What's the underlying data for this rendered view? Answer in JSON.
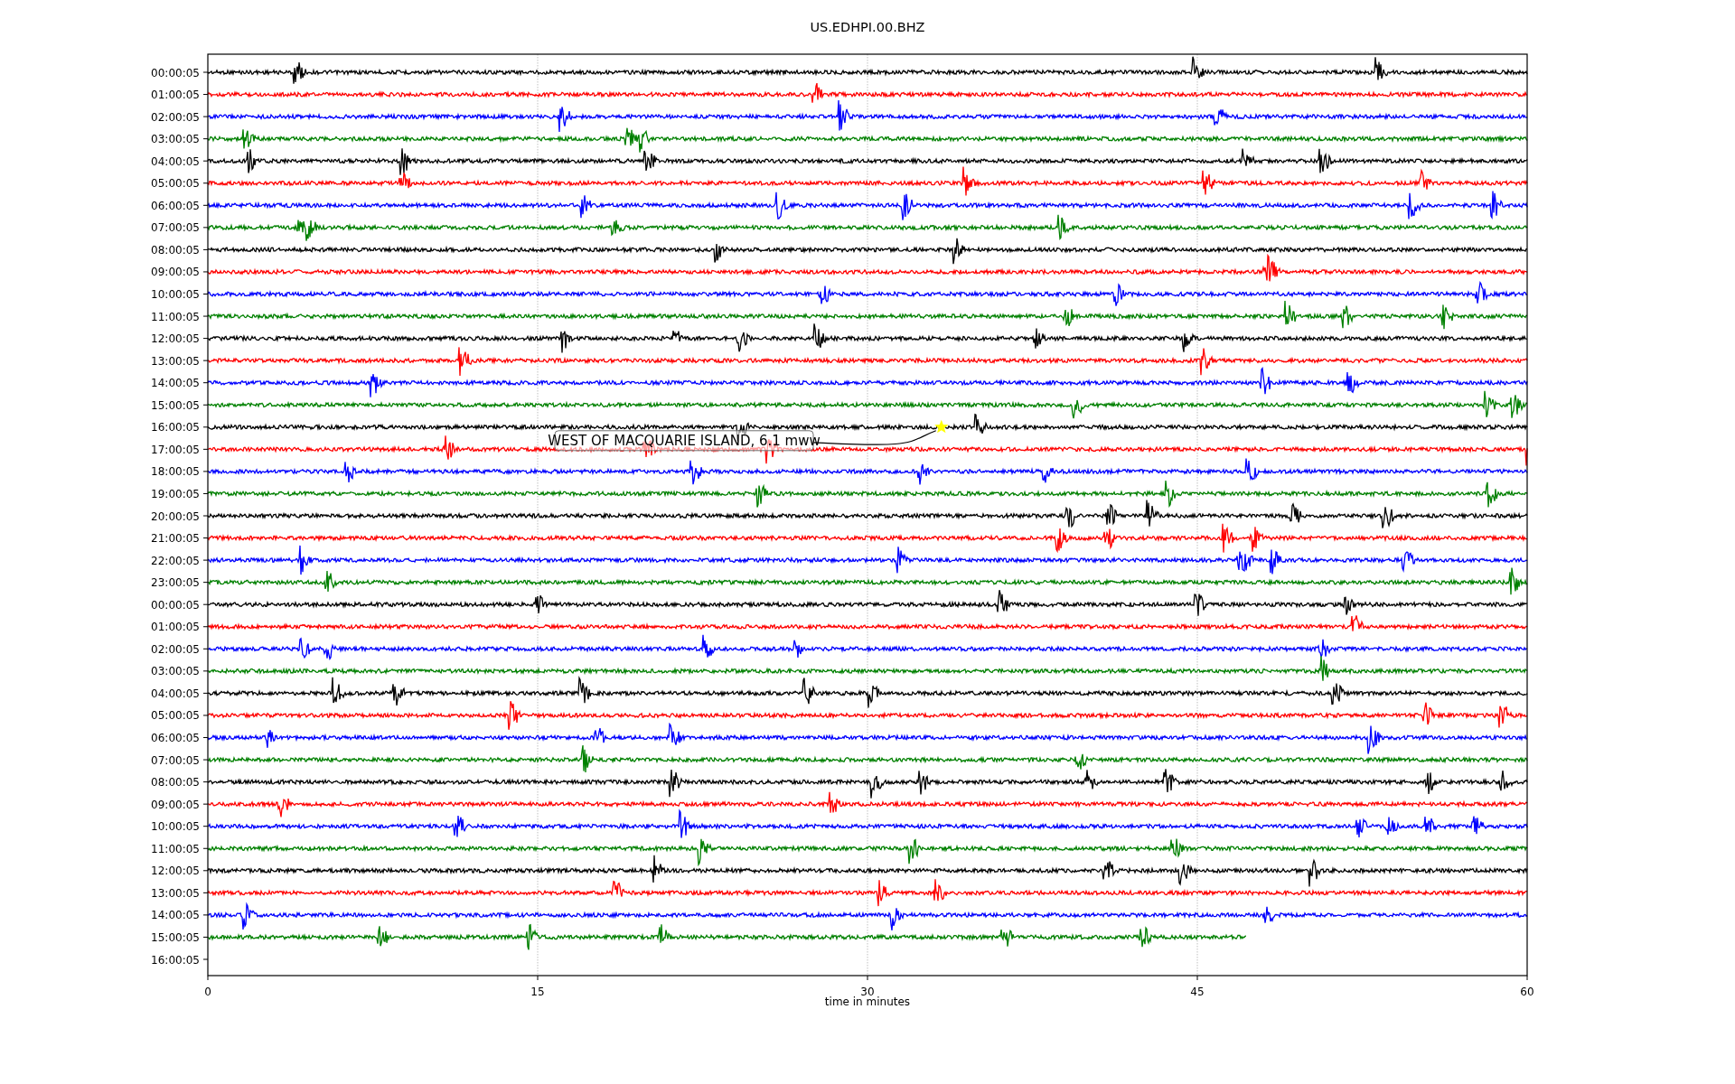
{
  "title": "US.EDHPI.00.BHZ",
  "plot": {
    "xlabel": "time in minutes",
    "xticks": [
      "0",
      "15",
      "30",
      "45",
      "60"
    ],
    "rows": [
      {
        "label": "00:00:05",
        "color": "#000000",
        "level": 1
      },
      {
        "label": "01:00:05",
        "color": "#ff0000",
        "level": 1
      },
      {
        "label": "02:00:05",
        "color": "#0000ff",
        "level": 1
      },
      {
        "label": "03:00:05",
        "color": "#008000",
        "level": 1
      },
      {
        "label": "04:00:05",
        "color": "#000000",
        "level": 1
      },
      {
        "label": "05:00:05",
        "color": "#ff0000",
        "level": 1
      },
      {
        "label": "06:00:05",
        "color": "#0000ff",
        "level": 1
      },
      {
        "label": "07:00:05",
        "color": "#008000",
        "level": 1
      },
      {
        "label": "08:00:05",
        "color": "#000000",
        "level": 1
      },
      {
        "label": "09:00:05",
        "color": "#ff0000",
        "level": 1
      },
      {
        "label": "10:00:05",
        "color": "#0000ff",
        "level": 1
      },
      {
        "label": "11:00:05",
        "color": "#008000",
        "level": 1
      },
      {
        "label": "12:00:05",
        "color": "#000000",
        "level": 1
      },
      {
        "label": "13:00:05",
        "color": "#ff0000",
        "level": 1
      },
      {
        "label": "14:00:05",
        "color": "#0000ff",
        "level": 1
      },
      {
        "label": "15:00:05",
        "color": "#008000",
        "level": 1
      },
      {
        "label": "16:00:05",
        "color": "#000000",
        "level": 1,
        "event": {
          "label": "WEST OF MACQUARIE ISLAND, 6.1 mww"
        }
      },
      {
        "label": "17:00:05",
        "color": "#ff0000",
        "level": 1
      },
      {
        "label": "18:00:05",
        "color": "#0000ff",
        "level": 1
      },
      {
        "label": "19:00:05",
        "color": "#008000",
        "level": 1
      },
      {
        "label": "20:00:05",
        "color": "#000000",
        "level": 1
      },
      {
        "label": "21:00:05",
        "color": "#ff0000",
        "level": 1
      },
      {
        "label": "22:00:05",
        "color": "#0000ff",
        "level": 1
      },
      {
        "label": "23:00:05",
        "color": "#008000",
        "level": 1
      },
      {
        "label": "00:00:05",
        "color": "#000000",
        "level": 1
      },
      {
        "label": "01:00:05",
        "color": "#ff0000",
        "level": 1
      },
      {
        "label": "02:00:05",
        "color": "#0000ff",
        "level": 1
      },
      {
        "label": "03:00:05",
        "color": "#008000",
        "level": 1
      },
      {
        "label": "04:00:05",
        "color": "#000000",
        "level": 1
      },
      {
        "label": "05:00:05",
        "color": "#ff0000",
        "level": 1
      },
      {
        "label": "06:00:05",
        "color": "#0000ff",
        "level": 1
      },
      {
        "label": "07:00:05",
        "color": "#008000",
        "level": 1
      },
      {
        "label": "08:00:05",
        "color": "#000000",
        "level": 1
      },
      {
        "label": "09:00:05",
        "color": "#ff0000",
        "level": 1
      },
      {
        "label": "10:00:05",
        "color": "#0000ff",
        "level": 1
      },
      {
        "label": "11:00:05",
        "color": "#008000",
        "level": 1
      },
      {
        "label": "12:00:05",
        "color": "#000000",
        "level": 1
      },
      {
        "label": "13:00:05",
        "color": "#ff0000",
        "level": 1
      },
      {
        "label": "14:00:05",
        "color": "#0000ff",
        "level": 1
      },
      {
        "label": "15:00:05",
        "color": "#008000",
        "level": 0.787
      },
      {
        "label": "16:00:05"
      }
    ]
  }
}
